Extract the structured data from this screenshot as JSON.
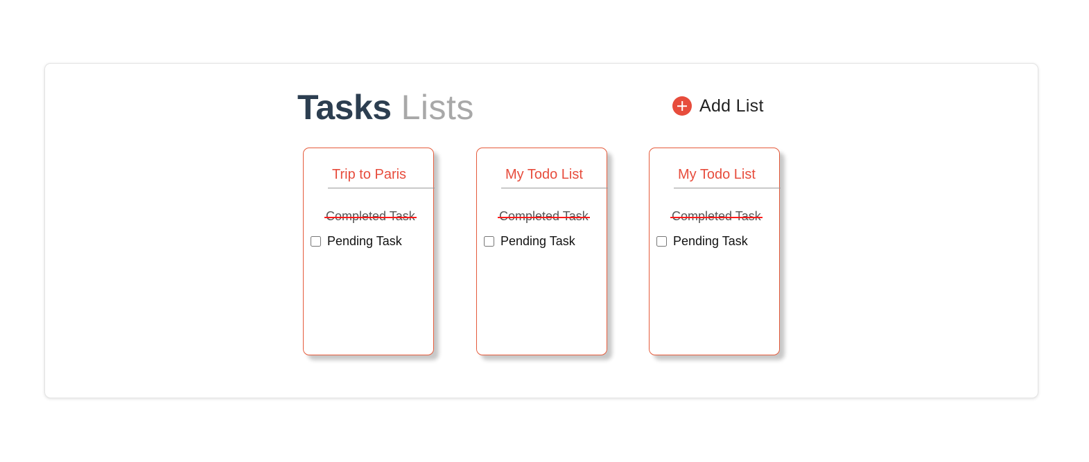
{
  "header": {
    "title_strong": "Tasks",
    "title_light": "Lists",
    "add_list_label": "Add List",
    "add_list_icon": "plus-circle-icon"
  },
  "colors": {
    "accent": "#e74c3c",
    "title": "#2c3e50",
    "card_border": "#e55a3a",
    "strike": "#ff1a1a"
  },
  "lists": [
    {
      "title": "Trip to Paris",
      "tasks": [
        {
          "label": "Completed Task",
          "completed": true
        },
        {
          "label": "Pending Task",
          "completed": false
        }
      ]
    },
    {
      "title": "My Todo List",
      "tasks": [
        {
          "label": "Completed Task",
          "completed": true
        },
        {
          "label": "Pending Task",
          "completed": false
        }
      ]
    },
    {
      "title": "My Todo List",
      "tasks": [
        {
          "label": "Completed Task",
          "completed": true
        },
        {
          "label": "Pending Task",
          "completed": false
        }
      ]
    }
  ]
}
